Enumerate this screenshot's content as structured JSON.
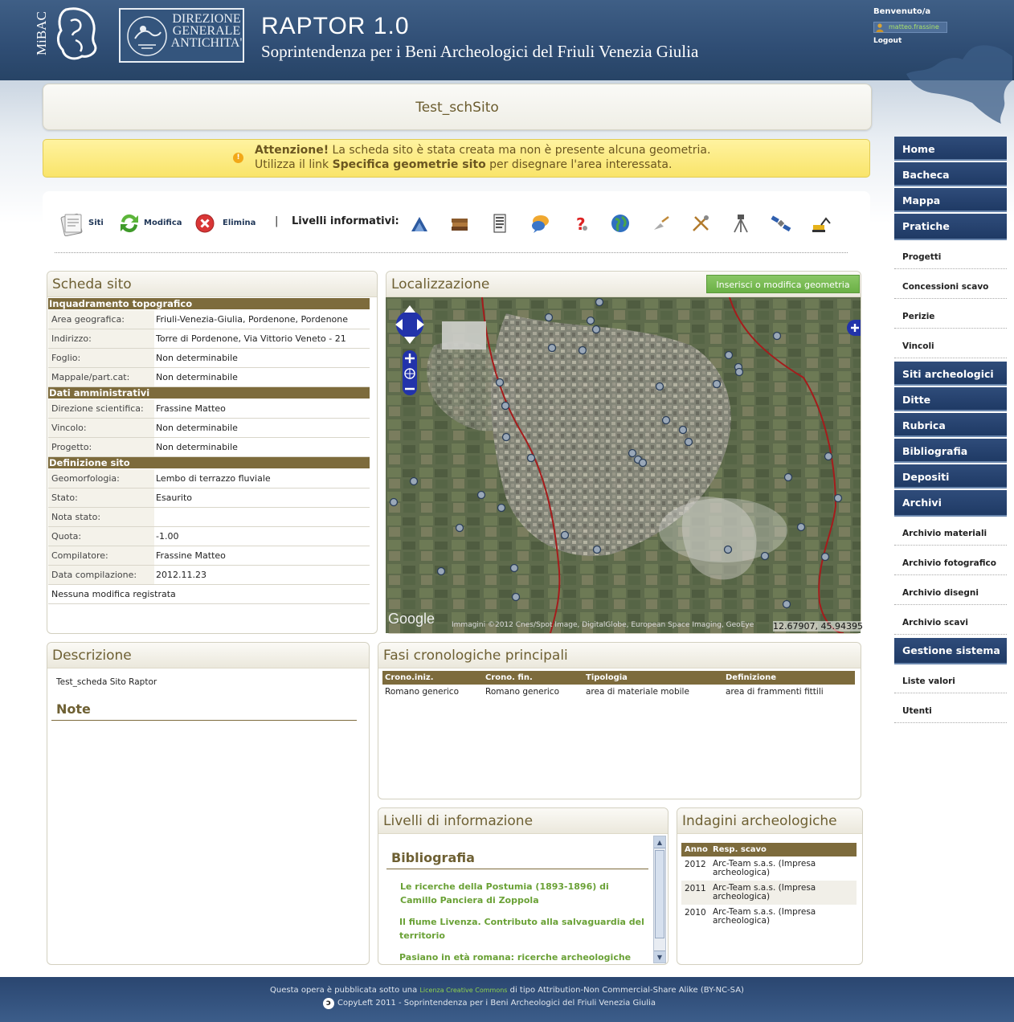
{
  "header": {
    "logo_mibac": "MiBAC",
    "logo_dga": "DIREZIONE GENERALE ANTICHITA'",
    "title": "RAPTOR 1.0",
    "subtitle": "Soprintendenza per i Beni Archeologici del Friuli Venezia Giulia",
    "welcome": "Benvenuto/a",
    "username": "matteo.frassine",
    "logout": "Logout"
  },
  "page": {
    "title": "Test_schSito"
  },
  "warning": {
    "strong": "Attenzione!",
    "text1": " La scheda sito è stata creata ma non è presente alcuna geometria.",
    "text2_pre": "Utilizza il link ",
    "text2_link": "Specifica geometrie sito",
    "text2_post": " per disegnare l'area interessata."
  },
  "toolbar": {
    "siti": "Siti",
    "modifica": "Modifica",
    "elimina": "Elimina",
    "separator": "|",
    "levels_label": "Livelli informativi:",
    "level_icons": [
      "archaeology-icon",
      "books-icon",
      "document-icon",
      "comment-icon",
      "question-icon",
      "globe-icon",
      "trowel-icon",
      "tools-icon",
      "survey-icon",
      "satellite-icon",
      "excavator-icon"
    ]
  },
  "scheda": {
    "title": "Scheda sito",
    "sections": [
      {
        "head": "Inquadramento topografico",
        "rows": [
          {
            "label": "Area geografica:",
            "value": "Friuli-Venezia-Giulia, Pordenone, Pordenone"
          },
          {
            "label": "Indirizzo:",
            "value": "Torre di Pordenone, Via Vittorio Veneto - 21"
          },
          {
            "label": "Foglio:",
            "value": "Non determinabile"
          },
          {
            "label": "Mappale/part.cat:",
            "value": "Non determinabile"
          }
        ]
      },
      {
        "head": "Dati amministrativi",
        "rows": [
          {
            "label": "Direzione scientifica:",
            "value": "Frassine Matteo"
          },
          {
            "label": "Vincolo:",
            "value": "Non determinabile"
          },
          {
            "label": "Progetto:",
            "value": "Non determinabile"
          }
        ]
      },
      {
        "head": "Definizione sito",
        "rows": [
          {
            "label": "Geomorfologia:",
            "value": "Lembo di terrazzo fluviale"
          },
          {
            "label": "Stato:",
            "value": "Esaurito"
          },
          {
            "label": "Nota stato:",
            "value": ""
          },
          {
            "label": "Quota:",
            "value": "-1.00"
          },
          {
            "label": "Compilatore:",
            "value": "Frassine Matteo"
          },
          {
            "label": "Data compilazione:",
            "value": "2012.11.23"
          }
        ]
      }
    ],
    "footer_note": "Nessuna modifica registrata"
  },
  "map": {
    "title": "Localizzazione",
    "button": "Inserisci o modifica geometria",
    "google": "Google",
    "credit": "Immagini ©2012 Cnes/Spot Image, DigitalGlobe, European Space Imaging, GeoEye",
    "coords": "12.67907, 45.94395"
  },
  "descrizione": {
    "title": "Descrizione",
    "text": "Test_scheda Sito Raptor",
    "note_head": "Note"
  },
  "fasi": {
    "title": "Fasi cronologiche principali",
    "columns": [
      "Crono.iniz.",
      "Crono. fin.",
      "Tipologia",
      "Definizione"
    ],
    "rows": [
      [
        "Romano generico",
        "Romano generico",
        "area di materiale mobile",
        "area di frammenti fittili"
      ]
    ]
  },
  "livelli": {
    "title": "Livelli di informazione",
    "section": "Bibliografia",
    "items": [
      "Le ricerche della Postumia (1893-1896) di Camillo Panciera di Zoppola",
      "Il fiume Livenza. Contributo alla salvaguardia del territorio",
      "Pasiano in età romana: ricerche archeologiche"
    ]
  },
  "indagini": {
    "title": "Indagini archeologiche",
    "columns": [
      "Anno",
      "Resp. scavo"
    ],
    "rows": [
      [
        "2012",
        "Arc-Team s.a.s. (Impresa archeologica)"
      ],
      [
        "2011",
        "Arc-Team s.a.s. (Impresa archeologica)"
      ],
      [
        "2010",
        "Arc-Team s.a.s. (Impresa archeologica)"
      ]
    ]
  },
  "nav": {
    "home": "Home",
    "bacheca": "Bacheca",
    "mappa": "Mappa",
    "pratiche": "Pratiche",
    "progetti": "Progetti",
    "concessioni": "Concessioni scavo",
    "perizie": "Perizie",
    "vincoli": "Vincoli",
    "siti": "Siti archeologici",
    "ditte": "Ditte",
    "rubrica": "Rubrica",
    "bibliografia": "Bibliografia",
    "depositi": "Depositi",
    "archivi": "Archivi",
    "arch_materiali": "Archivio materiali",
    "arch_foto": "Archivio fotografico",
    "arch_disegni": "Archivio disegni",
    "arch_scavi": "Archivio scavi",
    "gestione": "Gestione sistema",
    "liste": "Liste valori",
    "utenti": "Utenti"
  },
  "footer": {
    "line1_pre": "Questa opera è pubblicata sotto una ",
    "line1_link": "Licenza Creative Commons",
    "line1_post": " di tipo Attribution-Non Commercial-Share Alike (BY-NC-SA)",
    "line2": "CopyLeft 2011 - Soprintendenza per i Beni Archeologici del Friuli Venezia Giulia"
  }
}
